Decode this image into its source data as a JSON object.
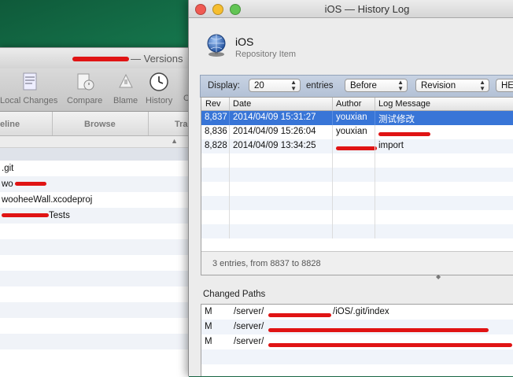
{
  "colors": {
    "selection": "#3875d7",
    "redaction": "#e01414",
    "filter_bar": "#b8c6da"
  },
  "back_window": {
    "title": "— Versions",
    "toolbar": [
      {
        "label": "Local Changes",
        "icon": "local-changes-icon"
      },
      {
        "label": "Compare",
        "icon": "compare-icon"
      },
      {
        "label": "Blame",
        "icon": "blame-icon"
      },
      {
        "label": "History",
        "icon": "clock-icon"
      },
      {
        "label": "C",
        "icon": ""
      }
    ],
    "tabs": [
      "eline",
      "Browse",
      "Tra"
    ],
    "rows": [
      ".git",
      "wo",
      "wooheeWall.xcodeproj",
      "Tests"
    ]
  },
  "front_window": {
    "title": "iOS — History Log",
    "repo": {
      "name": "iOS",
      "subtitle": "Repository Item",
      "icon": "globe-icon"
    },
    "filter": {
      "display_label": "Display:",
      "count": "20",
      "entries_label": "entries",
      "direction": "Before",
      "mode": "Revision",
      "head": "HEA"
    },
    "log": {
      "columns": [
        "Rev",
        "Date",
        "Author",
        "Log Message"
      ],
      "rows": [
        {
          "rev": "8,837",
          "date": "2014/04/09 15:31:27",
          "author": "youxian",
          "message": "测试修改",
          "selected": true
        },
        {
          "rev": "8,836",
          "date": "2014/04/09 15:26:04",
          "author": "youxian",
          "message": "",
          "selected": false
        },
        {
          "rev": "8,828",
          "date": "2014/04/09 13:34:25",
          "author": "",
          "message": "import",
          "selected": false
        }
      ],
      "summary": "3 entries, from 8837 to 8828"
    },
    "changed_paths": {
      "label": "Changed Paths",
      "rows": [
        {
          "action": "M",
          "path": "/server/",
          "tail": "/iOS/.git/index"
        },
        {
          "action": "M",
          "path": "/server/",
          "tail": ""
        },
        {
          "action": "M",
          "path": "/server/",
          "tail": ""
        }
      ]
    }
  }
}
